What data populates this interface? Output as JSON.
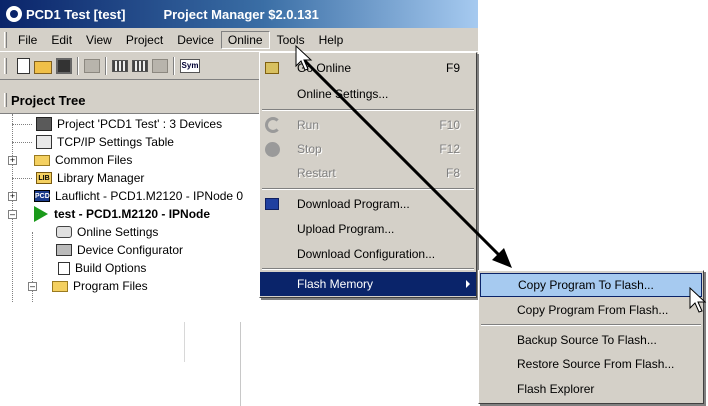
{
  "window": {
    "title": "PCD1 Test [test]",
    "subtitle": "Project Manager $2.0.131"
  },
  "menubar": {
    "items": [
      {
        "label": "File"
      },
      {
        "label": "Edit"
      },
      {
        "label": "View"
      },
      {
        "label": "Project"
      },
      {
        "label": "Device"
      },
      {
        "label": "Online"
      },
      {
        "label": "Tools"
      },
      {
        "label": "Help"
      }
    ]
  },
  "toolbar": {
    "sym_label": "Sym"
  },
  "project_tree": {
    "header": "Project Tree",
    "rows": [
      {
        "label": "Project 'PCD1 Test' : 3 Devices",
        "icon": "project-icon"
      },
      {
        "label": "TCP/IP Settings Table",
        "icon": "network-icon"
      },
      {
        "label": "Common Files",
        "icon": "folder-icon"
      },
      {
        "label": "Library Manager",
        "icon": "library-icon",
        "badge": "LIB"
      },
      {
        "label": "Lauflicht - PCD1.M2120 - IPNode 0",
        "icon": "pcd-icon",
        "badge": "PCD"
      },
      {
        "label": "test - PCD1.M2120 - IPNode",
        "icon": "play-icon"
      },
      {
        "label": "Online Settings",
        "icon": "online-settings-icon"
      },
      {
        "label": "Device Configurator",
        "icon": "device-configurator-icon"
      },
      {
        "label": "Build Options",
        "icon": "build-options-icon"
      },
      {
        "label": "Program Files",
        "icon": "folder-icon"
      }
    ]
  },
  "online_menu": {
    "items": [
      {
        "label": "Go Online",
        "shortcut": "F9"
      },
      {
        "label": "Online Settings...",
        "shortcut": ""
      },
      {
        "label": "Run",
        "shortcut": "F10"
      },
      {
        "label": "Stop",
        "shortcut": "F12"
      },
      {
        "label": "Restart",
        "shortcut": "F8"
      },
      {
        "label": "Download Program...",
        "shortcut": ""
      },
      {
        "label": "Upload Program...",
        "shortcut": ""
      },
      {
        "label": "Download Configuration...",
        "shortcut": ""
      },
      {
        "label": "Flash Memory",
        "shortcut": ""
      }
    ]
  },
  "flash_submenu": {
    "items": [
      {
        "label": "Copy Program To Flash..."
      },
      {
        "label": "Copy Program From Flash..."
      },
      {
        "label": "Backup Source To Flash..."
      },
      {
        "label": "Restore Source From Flash..."
      },
      {
        "label": "Flash Explorer"
      }
    ]
  },
  "colors": {
    "title_bar": "#0a246a",
    "menu_bg": "#d4d0c8",
    "highlight": "#0a246a",
    "submenu_hover": "#a6caf0"
  }
}
